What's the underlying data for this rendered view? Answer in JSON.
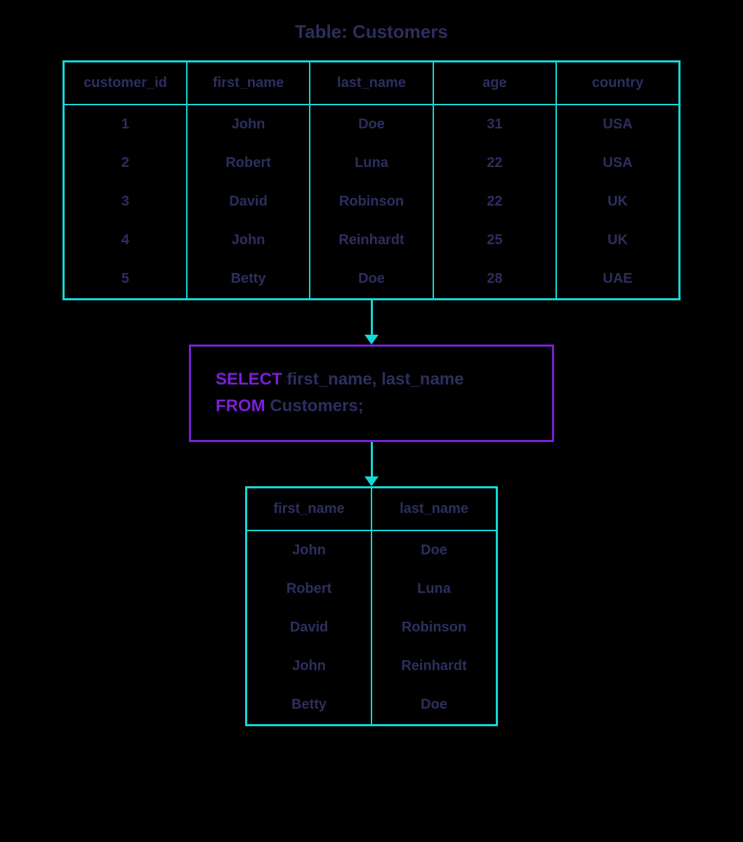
{
  "title": "Table: Customers",
  "source_table": {
    "headers": [
      "customer_id",
      "first_name",
      "last_name",
      "age",
      "country"
    ],
    "rows": [
      [
        "1",
        "John",
        "Doe",
        "31",
        "USA"
      ],
      [
        "2",
        "Robert",
        "Luna",
        "22",
        "USA"
      ],
      [
        "3",
        "David",
        "Robinson",
        "22",
        "UK"
      ],
      [
        "4",
        "John",
        "Reinhardt",
        "25",
        "UK"
      ],
      [
        "5",
        "Betty",
        "Doe",
        "28",
        "UAE"
      ]
    ]
  },
  "query": {
    "keyword1": "SELECT",
    "text1": " first_name, last_name",
    "keyword2": "FROM",
    "text2": " Customers;"
  },
  "result_table": {
    "headers": [
      "first_name",
      "last_name"
    ],
    "rows": [
      [
        "John",
        "Doe"
      ],
      [
        "Robert",
        "Luna"
      ],
      [
        "David",
        "Robinson"
      ],
      [
        "John",
        "Reinhardt"
      ],
      [
        "Betty",
        "Doe"
      ]
    ]
  }
}
